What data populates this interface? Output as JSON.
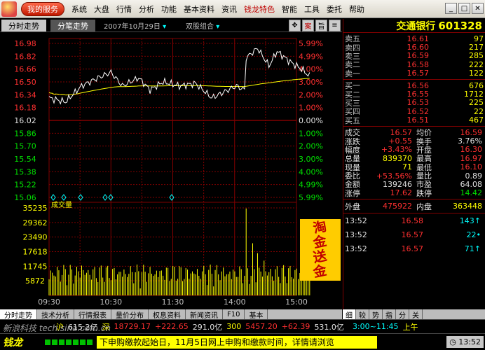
{
  "menubar": {
    "service_label": "我的服务",
    "items": [
      "系统",
      "大盘",
      "行情",
      "分析",
      "功能",
      "基本资料",
      "资讯",
      "钱龙特色",
      "智能",
      "工具",
      "委托",
      "帮助"
    ],
    "highlight_index": 7,
    "win_buttons": [
      "_",
      "□",
      "✕"
    ]
  },
  "tabbar": {
    "tab_intraday": "分时走势",
    "tab_ticks": "分笔走势",
    "date": "2007年10月29日",
    "combo": "双股组合",
    "tools": [
      "✥",
      "案",
      "旨",
      "≡"
    ]
  },
  "chart": {
    "price_labels": [
      "16.98",
      "16.82",
      "16.66",
      "16.50",
      "16.34",
      "16.18",
      "16.02",
      "15.86",
      "15.70",
      "15.54",
      "15.38",
      "15.22",
      "15.06"
    ],
    "pct_labels": [
      "5.99%",
      "4.99%",
      "4.00%",
      "3.00%",
      "2.00%",
      "1.00%",
      "0.00%",
      "1.00%",
      "2.00%",
      "3.00%",
      "4.00%",
      "4.99%",
      "5.99%"
    ],
    "volume_title": "成交量",
    "volume_labels": [
      "35235",
      "29362",
      "23490",
      "17618",
      "11745",
      "5872"
    ],
    "time_labels": [
      "09:30",
      "10:30",
      "11:30",
      "14:00",
      "15:00"
    ],
    "prev_close": 16.02,
    "y_range": [
      15.06,
      16.98
    ],
    "vol_max": 35235
  },
  "promo": {
    "line1": "淘",
    "line2": "金",
    "line3": "送",
    "line4": "金"
  },
  "stock": {
    "name": "交通银行",
    "code": "601328"
  },
  "asks": [
    {
      "label": "卖五",
      "price": "16.61",
      "vol": "97"
    },
    {
      "label": "卖四",
      "price": "16.60",
      "vol": "217"
    },
    {
      "label": "卖三",
      "price": "16.59",
      "vol": "285"
    },
    {
      "label": "卖二",
      "price": "16.58",
      "vol": "222"
    },
    {
      "label": "卖一",
      "price": "16.57",
      "vol": "122"
    }
  ],
  "bids": [
    {
      "label": "买一",
      "price": "16.56",
      "vol": "676"
    },
    {
      "label": "买二",
      "price": "16.55",
      "vol": "1712"
    },
    {
      "label": "买三",
      "price": "16.53",
      "vol": "225"
    },
    {
      "label": "买四",
      "price": "16.52",
      "vol": "22"
    },
    {
      "label": "买五",
      "price": "16.51",
      "vol": "467"
    }
  ],
  "stats": [
    {
      "k1": "成交",
      "v1": "16.57",
      "k2": "均价",
      "v2": "16.59",
      "c1": "red",
      "c2": "red"
    },
    {
      "k1": "涨跌",
      "v1": "+0.55",
      "k2": "换手",
      "v2": "3.76%",
      "c1": "red",
      "c2": "white"
    },
    {
      "k1": "幅度",
      "v1": "+3.43%",
      "k2": "开盘",
      "v2": "16.30",
      "c1": "red",
      "c2": "red"
    },
    {
      "k1": "总量",
      "v1": "839370",
      "k2": "最高",
      "v2": "16.97",
      "c1": "yellow",
      "c2": "red"
    },
    {
      "k1": "现量",
      "v1": "71",
      "k2": "最低",
      "v2": "16.10",
      "c1": "yellow",
      "c2": "red"
    },
    {
      "k1": "委比",
      "v1": "+53.56%",
      "k2": "量比",
      "v2": "0.89",
      "c1": "red",
      "c2": "white"
    },
    {
      "k1": "金额",
      "v1": "139246",
      "k2": "市盈",
      "v2": "64.08",
      "c1": "white",
      "c2": "white"
    },
    {
      "k1": "涨停",
      "v1": "17.62",
      "k2": "跌停",
      "v2": "14.42",
      "c1": "red",
      "c2": "green"
    }
  ],
  "outer_inner": {
    "out_label": "外盘",
    "out_val": "475922",
    "in_label": "内盘",
    "in_val": "363448"
  },
  "ticks": [
    {
      "time": "13:52",
      "price": "16.58",
      "vol": "143↑"
    },
    {
      "time": "13:52",
      "price": "16.57",
      "vol": "22•"
    },
    {
      "time": "13:52",
      "price": "16.57",
      "vol": "71↑"
    }
  ],
  "bottom_tabs": [
    "分时走势",
    "技术分析",
    "行情报表",
    "量价分布",
    "权息资料",
    "新闻资讯",
    "F10",
    "基本"
  ],
  "right_tabs": [
    "细",
    "较",
    "势",
    "指",
    "分",
    "关"
  ],
  "status": {
    "items": [
      {
        "t": "沪",
        "c": "yellow"
      },
      {
        "t": "615.2亿",
        "c": "white"
      },
      {
        "t": "深",
        "c": "yellow"
      },
      {
        "t": "18729.17",
        "c": "red"
      },
      {
        "t": "+222.65",
        "c": "red"
      },
      {
        "t": "291.0亿",
        "c": "white"
      },
      {
        "t": "300",
        "c": "yellow"
      },
      {
        "t": "5457.20",
        "c": "red"
      },
      {
        "t": "+62.39",
        "c": "red"
      },
      {
        "t": "531.0亿",
        "c": "white"
      }
    ],
    "right_info": "3:00~11:45",
    "right_label": "上午"
  },
  "ticker": {
    "logo": "钱龙",
    "text": "下申购缴款起始日，11月5日网上申购和缴款时间，详情请浏览",
    "clock": "13:52"
  },
  "watermark": "新浪科技 tech.sina.com.cn",
  "colors": {
    "up": "#ff3030",
    "down": "#00e000",
    "grid": "#800000",
    "price_line": "#ffffff",
    "avg_line": "#ffff00"
  }
}
